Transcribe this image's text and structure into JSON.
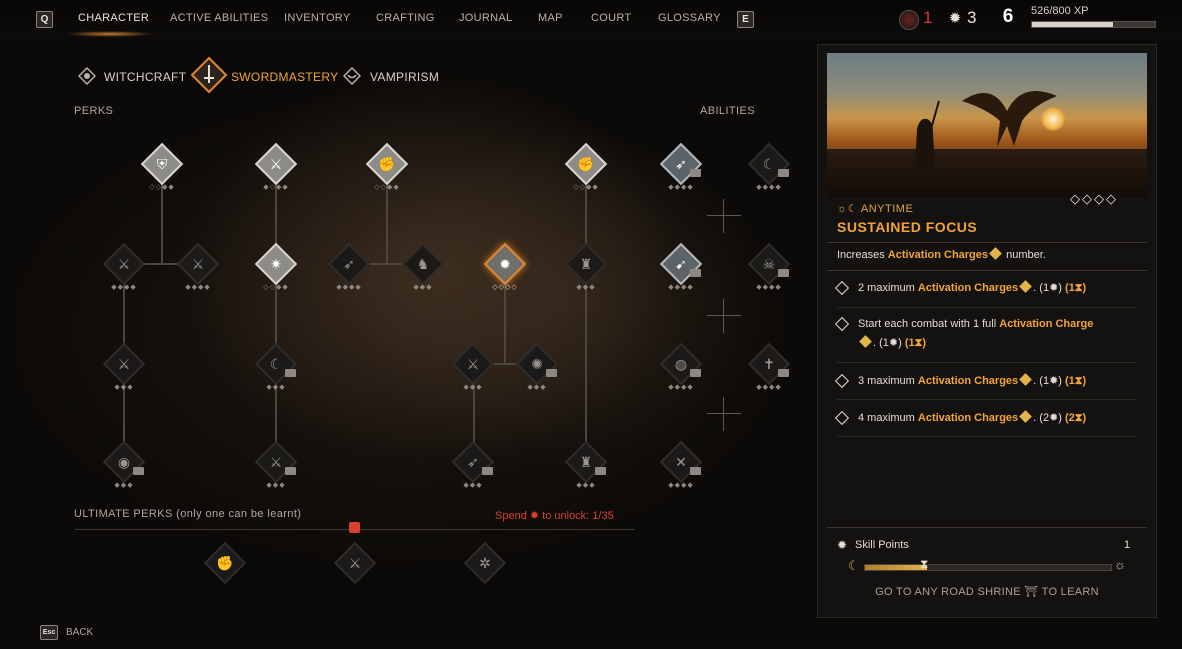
{
  "topbar": {
    "key_left": "Q",
    "key_right": "E",
    "tabs": [
      "CHARACTER",
      "ACTIVE ABILITIES",
      "INVENTORY",
      "CRAFTING",
      "JOURNAL",
      "MAP",
      "COURT",
      "GLOSSARY"
    ],
    "active_tab": "CHARACTER",
    "resource_red": "1",
    "resource_skill": "3",
    "level": "6",
    "xp_text": "526/800 XP",
    "xp_progress": 0.6575
  },
  "skill_tabs": [
    "WITCHCRAFT",
    "SWORDMASTERY",
    "VAMPIRISM"
  ],
  "selected_skill_tab": "SWORDMASTERY",
  "labels": {
    "perks": "PERKS",
    "abilities": "ABILITIES",
    "ultimate": "ULTIMATE PERKS (only one can be learnt)",
    "spend_prefix": "Spend",
    "spend_suffix": "to unlock: 1/35",
    "back_key": "Esc",
    "back": "BACK"
  },
  "detail": {
    "timing": "ANYTIME",
    "title": "SUSTAINED FOCUS",
    "desc_prefix": "Increases",
    "desc_keyword": "Activation Charges",
    "desc_suffix": "number.",
    "ranks": [
      {
        "prefix": "2 maximum",
        "keyword": "Activation Charges",
        "cost": "(1",
        "time": "(1"
      },
      {
        "prefix": "Start each combat with 1 full",
        "keyword": "Activation Charge",
        "cost": "(1",
        "time": "(1"
      },
      {
        "prefix": "3 maximum",
        "keyword": "Activation Charges",
        "cost": "(1",
        "time": "(1"
      },
      {
        "prefix": "4 maximum",
        "keyword": "Activation Charges",
        "cost": "(2",
        "time": "(2"
      }
    ],
    "skill_points_label": "Skill Points",
    "skill_points_value": "1",
    "shrine_text": "GO TO ANY ROAD SHRINE",
    "shrine_suffix": "TO LEARN"
  },
  "colors": {
    "accent": "#f2a33a",
    "spend": "#d8402f",
    "resource_red": "#d23a2f"
  }
}
